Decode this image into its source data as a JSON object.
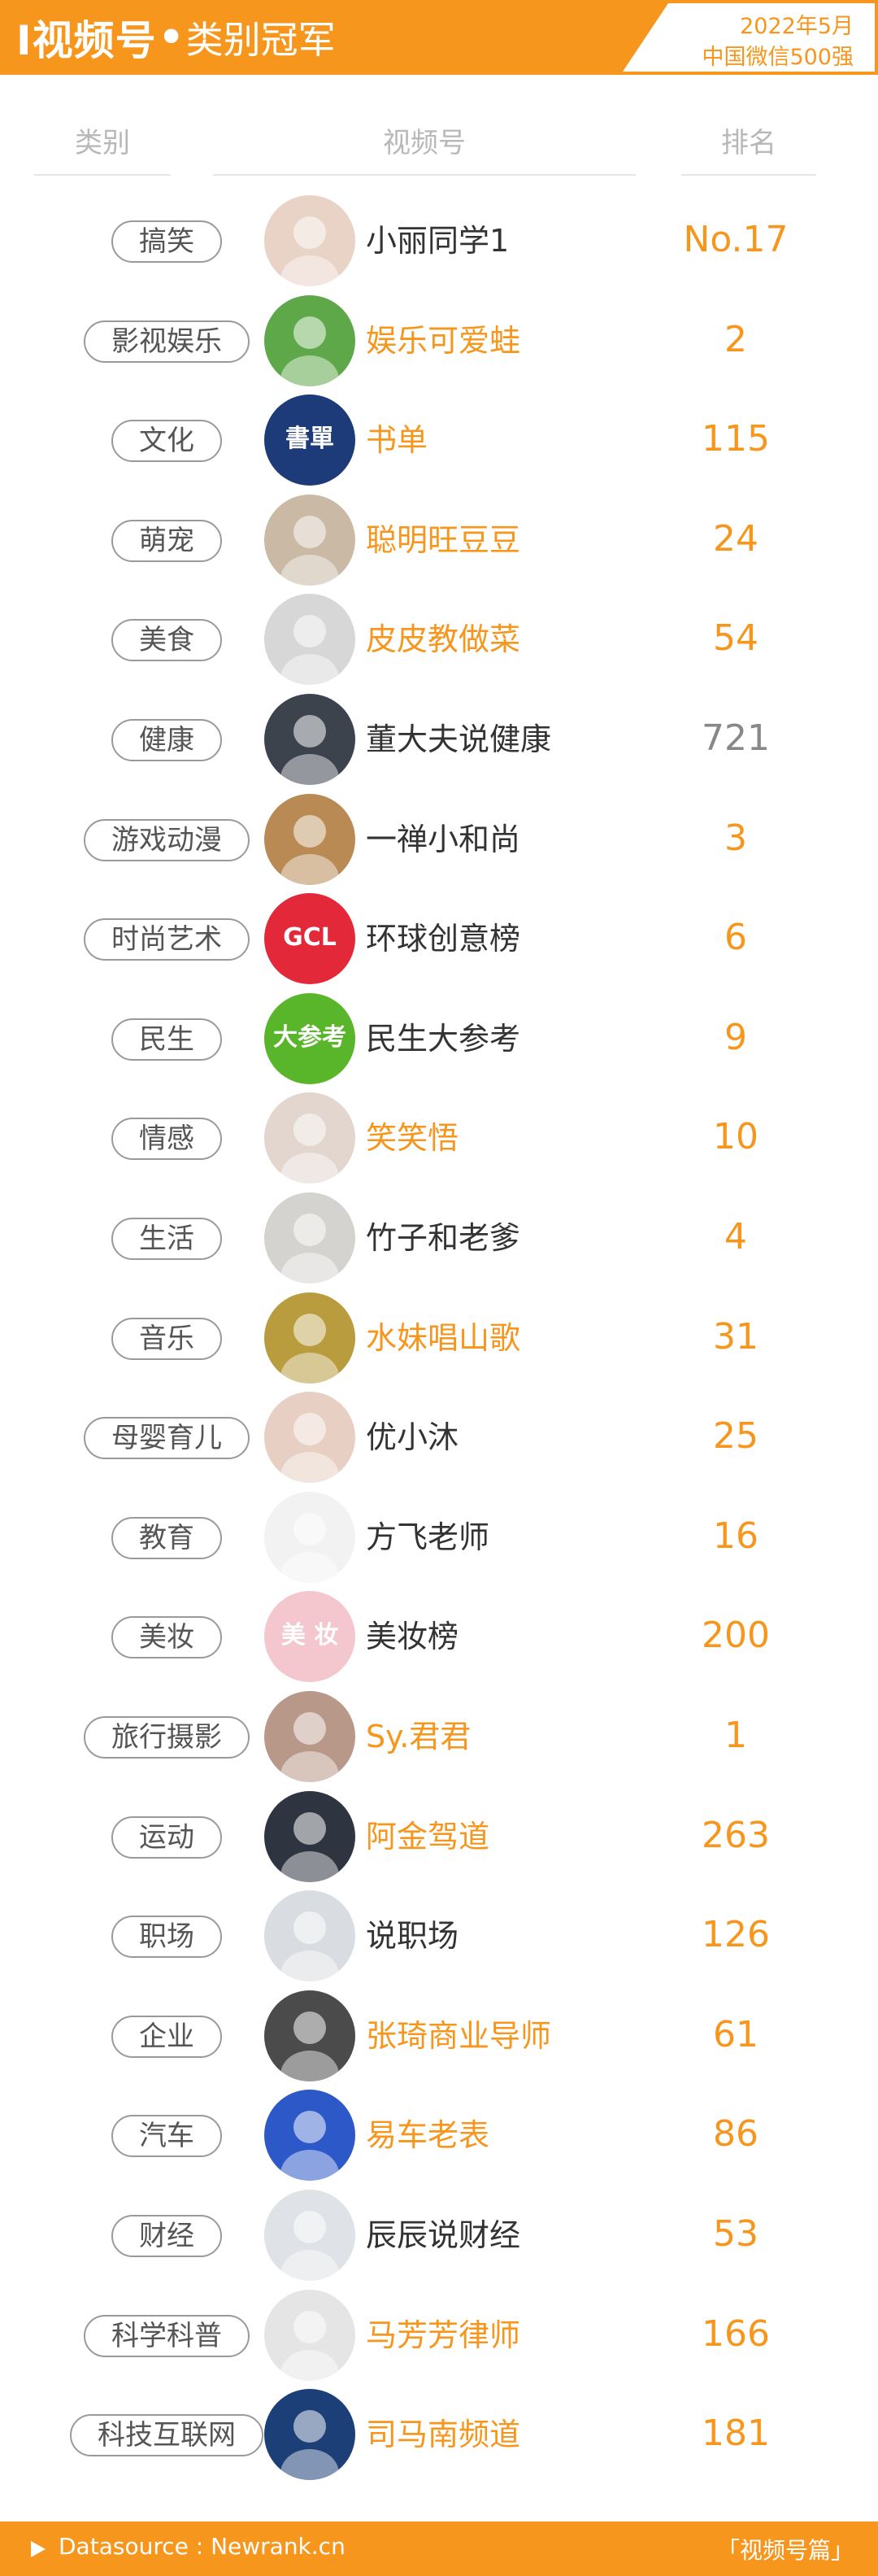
{
  "header": {
    "title_main": "I视频号",
    "title_dot": "•",
    "title_sub": "类别冠军",
    "date": "2022年5月",
    "subtitle": "中国微信500强"
  },
  "columns": {
    "category": "类别",
    "channel": "视频号",
    "rank": "排名"
  },
  "rows": [
    {
      "category": "搞笑",
      "name": "小丽同学1",
      "rank": "No.17",
      "name_color": "dark",
      "rank_color": "orange",
      "avatar_color": "#e9d2c6",
      "avatar_icon": "portrait-icon"
    },
    {
      "category": "影视娱乐",
      "name": "娱乐可爱蛙",
      "rank": "2",
      "name_color": "orange",
      "rank_color": "orange",
      "avatar_color": "#5fa84a",
      "avatar_icon": "frog-icon"
    },
    {
      "category": "文化",
      "name": "书单",
      "rank": "115",
      "name_color": "orange",
      "rank_color": "orange",
      "avatar_color": "#1c3b78",
      "avatar_icon": "book-logo-icon",
      "avatar_text": "書單"
    },
    {
      "category": "萌宠",
      "name": "聪明旺豆豆",
      "rank": "24",
      "name_color": "orange",
      "rank_color": "orange",
      "avatar_color": "#c9b9a5",
      "avatar_icon": "dog-icon"
    },
    {
      "category": "美食",
      "name": "皮皮教做菜",
      "rank": "54",
      "name_color": "orange",
      "rank_color": "orange",
      "avatar_color": "#d7d7d7",
      "avatar_icon": "portrait-icon"
    },
    {
      "category": "健康",
      "name": "董大夫说健康",
      "rank": "721",
      "name_color": "dark",
      "rank_color": "gray",
      "avatar_color": "#3d434d",
      "avatar_icon": "doctor-icon"
    },
    {
      "category": "游戏动漫",
      "name": "一禅小和尚",
      "rank": "3",
      "name_color": "dark",
      "rank_color": "orange",
      "avatar_color": "#b98a54",
      "avatar_icon": "monk-cartoon-icon"
    },
    {
      "category": "时尚艺术",
      "name": "环球创意榜",
      "rank": "6",
      "name_color": "dark",
      "rank_color": "orange",
      "avatar_color": "#e3283a",
      "avatar_icon": "heart-logo-icon",
      "avatar_text": "GCL"
    },
    {
      "category": "民生",
      "name": "民生大参考",
      "rank": "9",
      "name_color": "dark",
      "rank_color": "orange",
      "avatar_color": "#59b62a",
      "avatar_icon": "text-logo-icon",
      "avatar_text": "大参考"
    },
    {
      "category": "情感",
      "name": "笑笑悟",
      "rank": "10",
      "name_color": "orange",
      "rank_color": "orange",
      "avatar_color": "#e2d6cf",
      "avatar_icon": "portrait-icon"
    },
    {
      "category": "生活",
      "name": "竹子和老爹",
      "rank": "4",
      "name_color": "dark",
      "rank_color": "orange",
      "avatar_color": "#d5d3d0",
      "avatar_icon": "portrait-icon"
    },
    {
      "category": "音乐",
      "name": "水妹唱山歌",
      "rank": "31",
      "name_color": "orange",
      "rank_color": "orange",
      "avatar_color": "#b99c3e",
      "avatar_icon": "portrait-icon"
    },
    {
      "category": "母婴育儿",
      "name": "优小沐",
      "rank": "25",
      "name_color": "dark",
      "rank_color": "orange",
      "avatar_color": "#e8cfc3",
      "avatar_icon": "baby-icon"
    },
    {
      "category": "教育",
      "name": "方飞老师",
      "rank": "16",
      "name_color": "dark",
      "rank_color": "orange",
      "avatar_color": "#f2f2f2",
      "avatar_icon": "sketch-figure-icon"
    },
    {
      "category": "美妆",
      "name": "美妆榜",
      "rank": "200",
      "name_color": "dark",
      "rank_color": "orange",
      "avatar_color": "#f4c7cf",
      "avatar_icon": "text-logo-icon",
      "avatar_text": "美 妆"
    },
    {
      "category": "旅行摄影",
      "name": "Sy.君君",
      "rank": "1",
      "name_color": "orange",
      "rank_color": "orange",
      "avatar_color": "#b89888",
      "avatar_icon": "landscape-icon"
    },
    {
      "category": "运动",
      "name": "阿金驾道",
      "rank": "263",
      "name_color": "orange",
      "rank_color": "orange",
      "avatar_color": "#2f3540",
      "avatar_icon": "portrait-icon"
    },
    {
      "category": "职场",
      "name": "说职场",
      "rank": "126",
      "name_color": "dark",
      "rank_color": "orange",
      "avatar_color": "#d9dde1",
      "avatar_icon": "portrait-icon"
    },
    {
      "category": "企业",
      "name": "张琦商业导师",
      "rank": "61",
      "name_color": "orange",
      "rank_color": "orange",
      "avatar_color": "#4b4b4b",
      "avatar_icon": "portrait-icon"
    },
    {
      "category": "汽车",
      "name": "易车老表",
      "rank": "86",
      "name_color": "orange",
      "rank_color": "orange",
      "avatar_color": "#2c58c8",
      "avatar_icon": "portrait-icon"
    },
    {
      "category": "财经",
      "name": "辰辰说财经",
      "rank": "53",
      "name_color": "dark",
      "rank_color": "orange",
      "avatar_color": "#dfe2e6",
      "avatar_icon": "portrait-icon"
    },
    {
      "category": "科学科普",
      "name": "马芳芳律师",
      "rank": "166",
      "name_color": "orange",
      "rank_color": "orange",
      "avatar_color": "#e5e5e5",
      "avatar_icon": "portrait-icon"
    },
    {
      "category": "科技互联网",
      "name": "司马南频道",
      "rank": "181",
      "name_color": "orange",
      "rank_color": "orange",
      "avatar_color": "#1d3f78",
      "avatar_icon": "portrait-icon"
    }
  ],
  "footer": {
    "source": "Datasource : Newrank.cn",
    "tag": "「视频号篇」"
  }
}
